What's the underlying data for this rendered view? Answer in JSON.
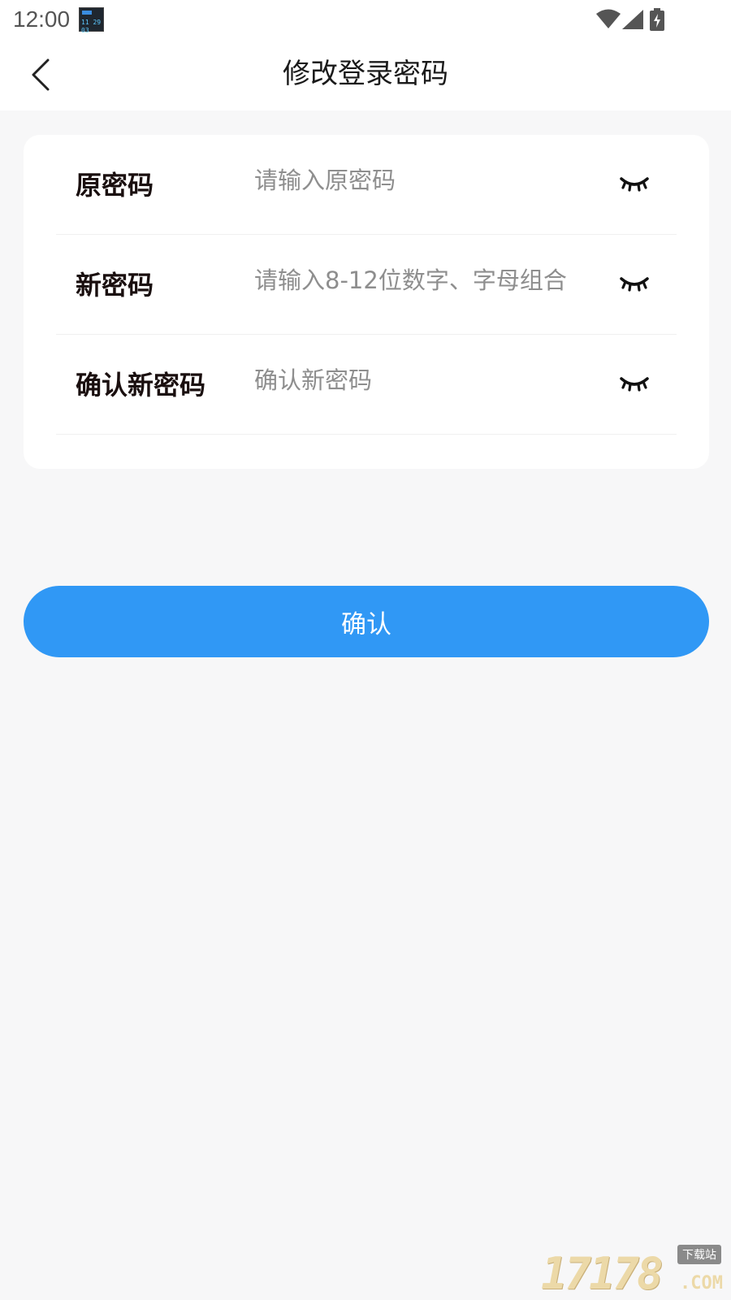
{
  "status_bar": {
    "time": "12:00",
    "app_icon_digits": "11 29 03",
    "icons": [
      "wifi-icon",
      "signal-icon",
      "battery-charging-icon"
    ]
  },
  "header": {
    "title": "修改登录密码",
    "back_icon": "chevron-left-icon"
  },
  "form": {
    "rows": [
      {
        "label": "原密码",
        "placeholder": "请输入原密码",
        "value": ""
      },
      {
        "label": "新密码",
        "placeholder": "请输入8-12位数字、字母组合",
        "value": ""
      },
      {
        "label": "确认新密码",
        "placeholder": "确认新密码",
        "value": ""
      }
    ],
    "toggle_icon": "eye-closed-icon"
  },
  "confirm_button": {
    "label": "确认"
  },
  "watermark": {
    "digits": "17178",
    "tag": "下载站",
    "suffix": ".COM"
  },
  "colors": {
    "background": "#f7f7f8",
    "accent": "#3098f5",
    "label_text": "#1a0f0f",
    "placeholder_text": "#8e8e8e"
  }
}
